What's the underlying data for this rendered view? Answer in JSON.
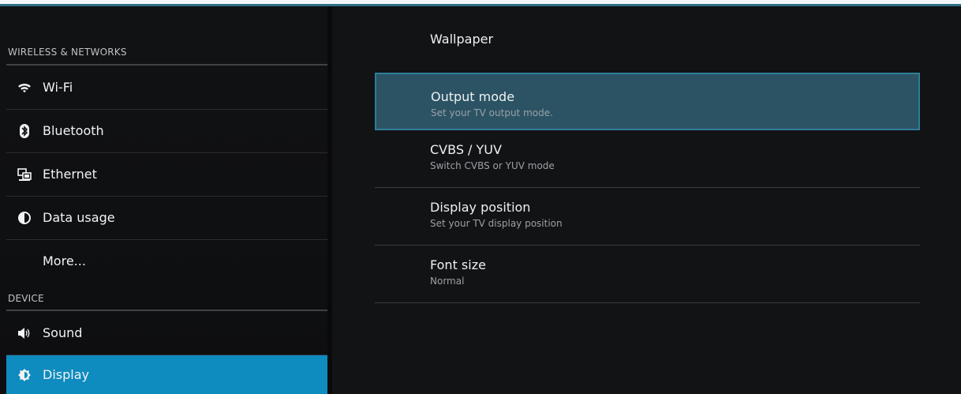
{
  "left_pane": {
    "sections": [
      {
        "header": "WIRELESS & NETWORKS",
        "items": [
          {
            "label": "Wi-Fi",
            "icon": "wifi-icon"
          },
          {
            "label": "Bluetooth",
            "icon": "bluetooth-icon"
          },
          {
            "label": "Ethernet",
            "icon": "ethernet-icon"
          },
          {
            "label": "Data usage",
            "icon": "data-usage-icon"
          },
          {
            "label": "More...",
            "icon": ""
          }
        ]
      },
      {
        "header": "DEVICE",
        "items": [
          {
            "label": "Sound",
            "icon": "speaker-icon"
          },
          {
            "label": "Display",
            "icon": "display-brightness-icon",
            "selected": true
          }
        ]
      }
    ]
  },
  "right_pane": {
    "items": [
      {
        "title": "Wallpaper",
        "summary": ""
      },
      {
        "title": "Output mode",
        "summary": "Set your TV output mode.",
        "focused": true
      },
      {
        "title": "CVBS / YUV",
        "summary": "Switch CVBS or YUV mode"
      },
      {
        "title": "Display position",
        "summary": "Set your TV display position"
      },
      {
        "title": "Font size",
        "summary": "Normal"
      }
    ]
  },
  "colors": {
    "accent": "#0e8bbf",
    "focused_bg": "#2b5364",
    "focused_border": "#2f7d99",
    "background": "#0a0a0b"
  }
}
